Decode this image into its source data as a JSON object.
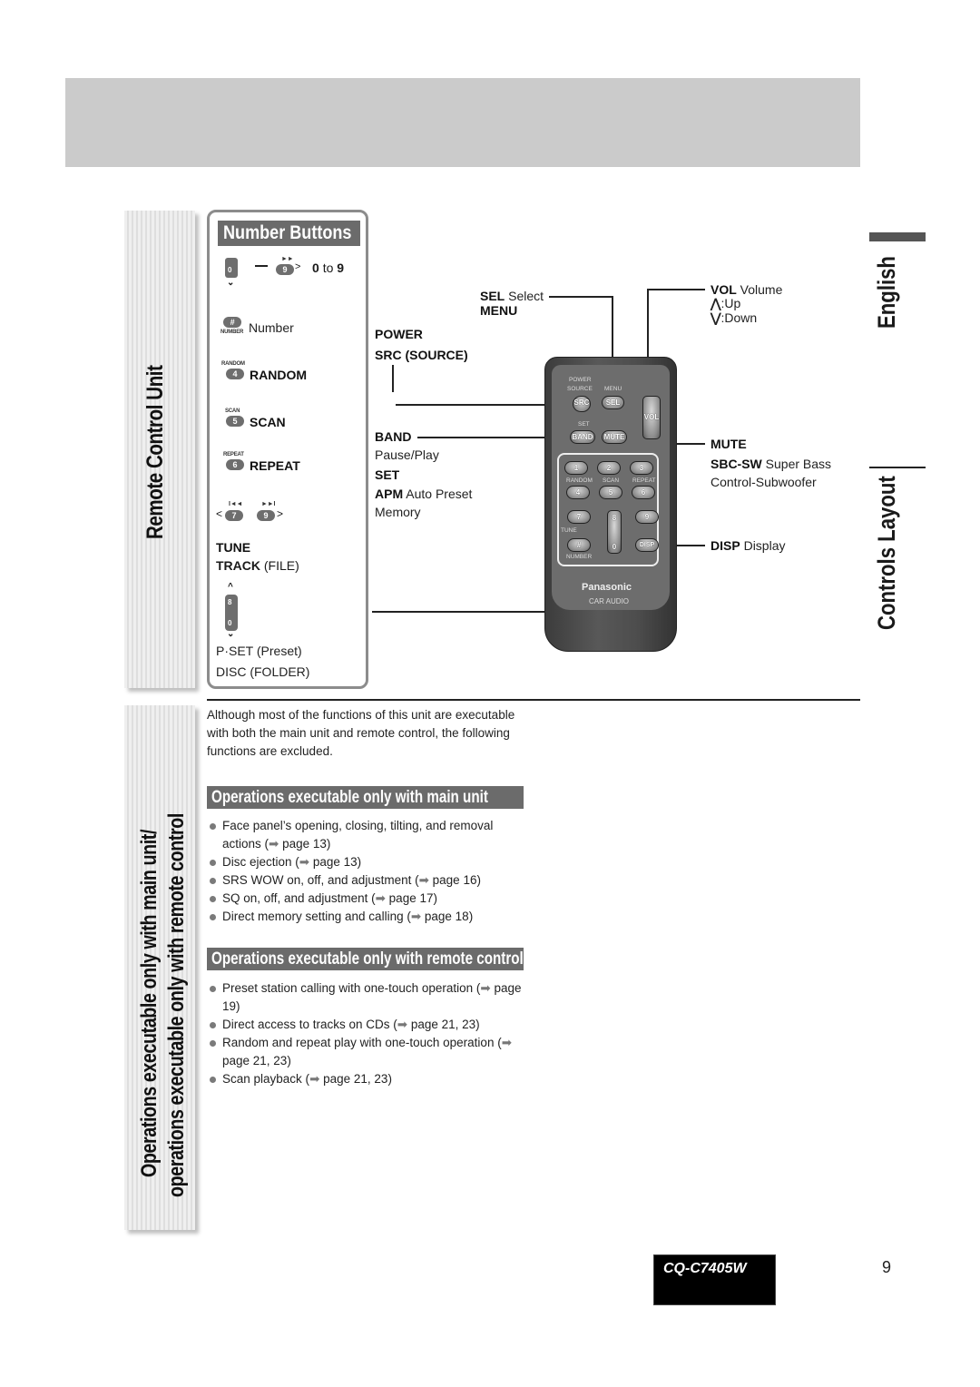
{
  "side_tabs": {
    "remote_control_unit": "Remote Control Unit",
    "operations_line1": "Operations executable only with main unit/",
    "operations_line2": "operations executable only with remote control"
  },
  "language": "English",
  "section_title": "Controls Layout",
  "number_buttons": {
    "title": "Number Buttons",
    "range_from_key": "0",
    "range_to_key": "9",
    "range_label_from": "0",
    "range_label_to_word": "to",
    "range_label_to": "9",
    "items": [
      {
        "key": "#",
        "caption": "NUMBER",
        "label": "Number",
        "bold": false
      },
      {
        "key": "4",
        "caption": "RANDOM",
        "label": "RANDOM",
        "bold": true
      },
      {
        "key": "5",
        "caption": "SCAN",
        "label": "SCAN",
        "bold": true
      },
      {
        "key": "6",
        "caption": "REPEAT",
        "label": "REPEAT",
        "bold": true
      }
    ],
    "tune_keys": [
      "7",
      "9"
    ],
    "tune_label": "TUNE",
    "track_label": "TRACK",
    "track_sub": "(FILE)",
    "rocker_keys": [
      "8",
      "0"
    ],
    "pset_label": "P·SET (Preset)",
    "disc_label": "DISC (FOLDER)"
  },
  "callouts_left": {
    "sel_bold": "SEL",
    "sel_text": "Select",
    "menu": "MENU",
    "power": "POWER",
    "src": "SRC (SOURCE)",
    "band": "BAND",
    "pause_play": "Pause/Play",
    "set": "SET",
    "apm_bold": "APM",
    "apm_text": "Auto Preset",
    "memory": "Memory"
  },
  "callouts_right": {
    "vol_bold": "VOL",
    "vol_text": "Volume",
    "up": ":Up",
    "down": ":Down",
    "mute": "MUTE",
    "sbc_bold": "SBC-SW",
    "sbc_text": "Super Bass",
    "sbc_text2": "Control-Subwoofer",
    "disp_bold": "DISP",
    "disp_text": "Display"
  },
  "remote": {
    "power_label": "POWER",
    "source_label": "SOURCE",
    "menu_label": "MENU",
    "src": "SRC",
    "sel": "SEL",
    "vol": "VOL",
    "set_label": "SET",
    "band": "BAND",
    "mute": "MUTE",
    "keys": [
      "1",
      "2",
      "3",
      "4",
      "5",
      "6",
      "7",
      "9",
      "#",
      "8",
      "0"
    ],
    "random": "RANDOM",
    "scan": "SCAN",
    "repeat": "REPEAT",
    "tune": "TUNE",
    "number": "NUMBER",
    "disp": "DISP",
    "brand": "Panasonic",
    "sub": "CAR AUDIO"
  },
  "intro": "Although most of the functions of this unit are executable with both the main unit and remote control, the following functions are excluded.",
  "main_unit_only": {
    "title": "Operations executable only with main unit",
    "items": [
      "Face panel’s opening, closing, tilting, and removal actions (➡ page 13)",
      "Disc ejection (➡ page 13)",
      "SRS WOW on, off, and adjustment (➡ page 16)",
      "SQ on, off, and adjustment (➡ page 17)",
      "Direct memory setting and calling (➡ page 18)"
    ]
  },
  "remote_only": {
    "title": "Operations executable only with remote control",
    "items": [
      "Preset station calling with one-touch operation (➡ page 19)",
      "Direct access to tracks on CDs (➡ page 21, 23)",
      "Random and repeat play with one-touch operation (➡ page 21, 23)",
      "Scan playback (➡ page 21, 23)"
    ]
  },
  "footer": {
    "model": "CQ-C7405W",
    "page": "9"
  }
}
